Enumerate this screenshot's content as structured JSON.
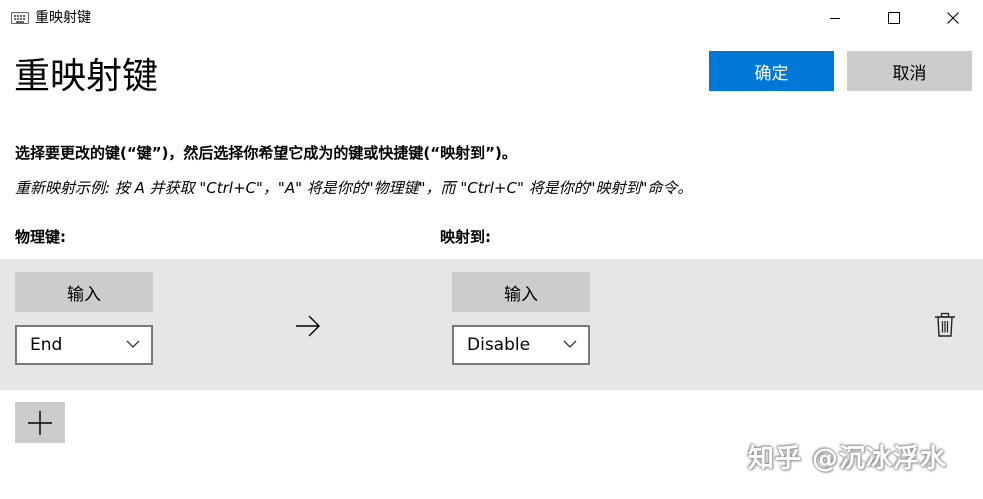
{
  "window": {
    "title": "重映射键",
    "icon": "keyboard-icon",
    "controls": [
      "minimize-icon",
      "maximize-icon",
      "close-icon"
    ]
  },
  "page": {
    "title": "重映射键"
  },
  "actions": {
    "ok_label": "确定",
    "cancel_label": "取消"
  },
  "instructions": {
    "main": "选择要更改的键(“键”)，然后选择你希望它成为的键或快捷键(“映射到”)。",
    "example": "重新映射示例: 按 A 并获取 \"Ctrl+C\"，\"A\" 将是你的\"物理键\"，而 \"Ctrl+C\" 将是你的\"映射到\"命令。"
  },
  "columns": {
    "physical": "物理键:",
    "mapped": "映射到:"
  },
  "mappings": [
    {
      "physical": {
        "type_label": "输入",
        "selected": "End"
      },
      "mapped": {
        "type_label": "输入",
        "selected": "Disable"
      }
    }
  ],
  "icons": {
    "arrow": "arrow-right-icon",
    "delete": "trash-icon",
    "add": "plus-icon",
    "dropdown": "chevron-down-icon"
  },
  "watermark": "知乎 @沉冰浮水",
  "colors": {
    "accent": "#0078d7",
    "button_gray": "#cccccc",
    "row_bg": "#e6e6e6"
  }
}
